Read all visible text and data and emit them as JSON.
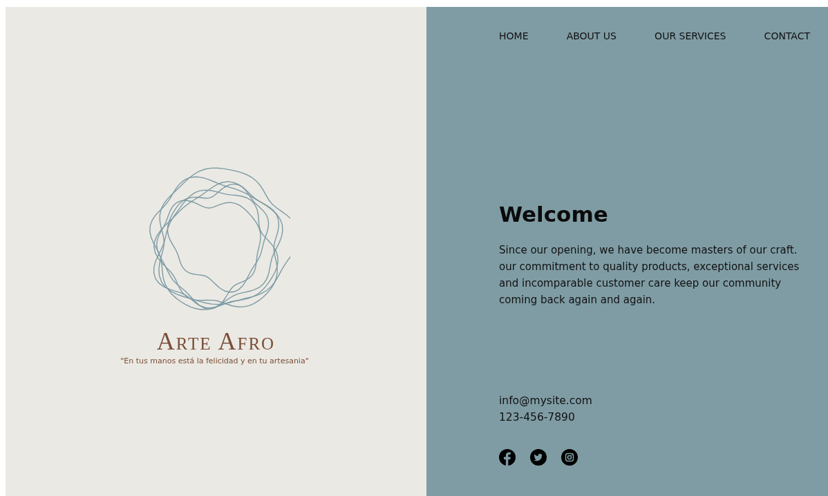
{
  "nav": [
    {
      "label": "HOME"
    },
    {
      "label": "ABOUT US"
    },
    {
      "label": "OUR SERVICES"
    },
    {
      "label": "CONTACT"
    }
  ],
  "brand": {
    "name": "Arte Afro",
    "tagline": "\"En tus manos está la felicidad y en tu artesania\""
  },
  "welcome": {
    "title": "Welcome",
    "text": "Since our opening, we have become masters of our craft. our commitment to quality products, exceptional services and incomparable customer care keep our community coming back again and again."
  },
  "contact": {
    "email": "info@mysite.com",
    "phone": "123-456-7890"
  },
  "social": [
    {
      "kind": "f"
    },
    {
      "kind": "bird"
    },
    {
      "kind": "camera"
    }
  ]
}
